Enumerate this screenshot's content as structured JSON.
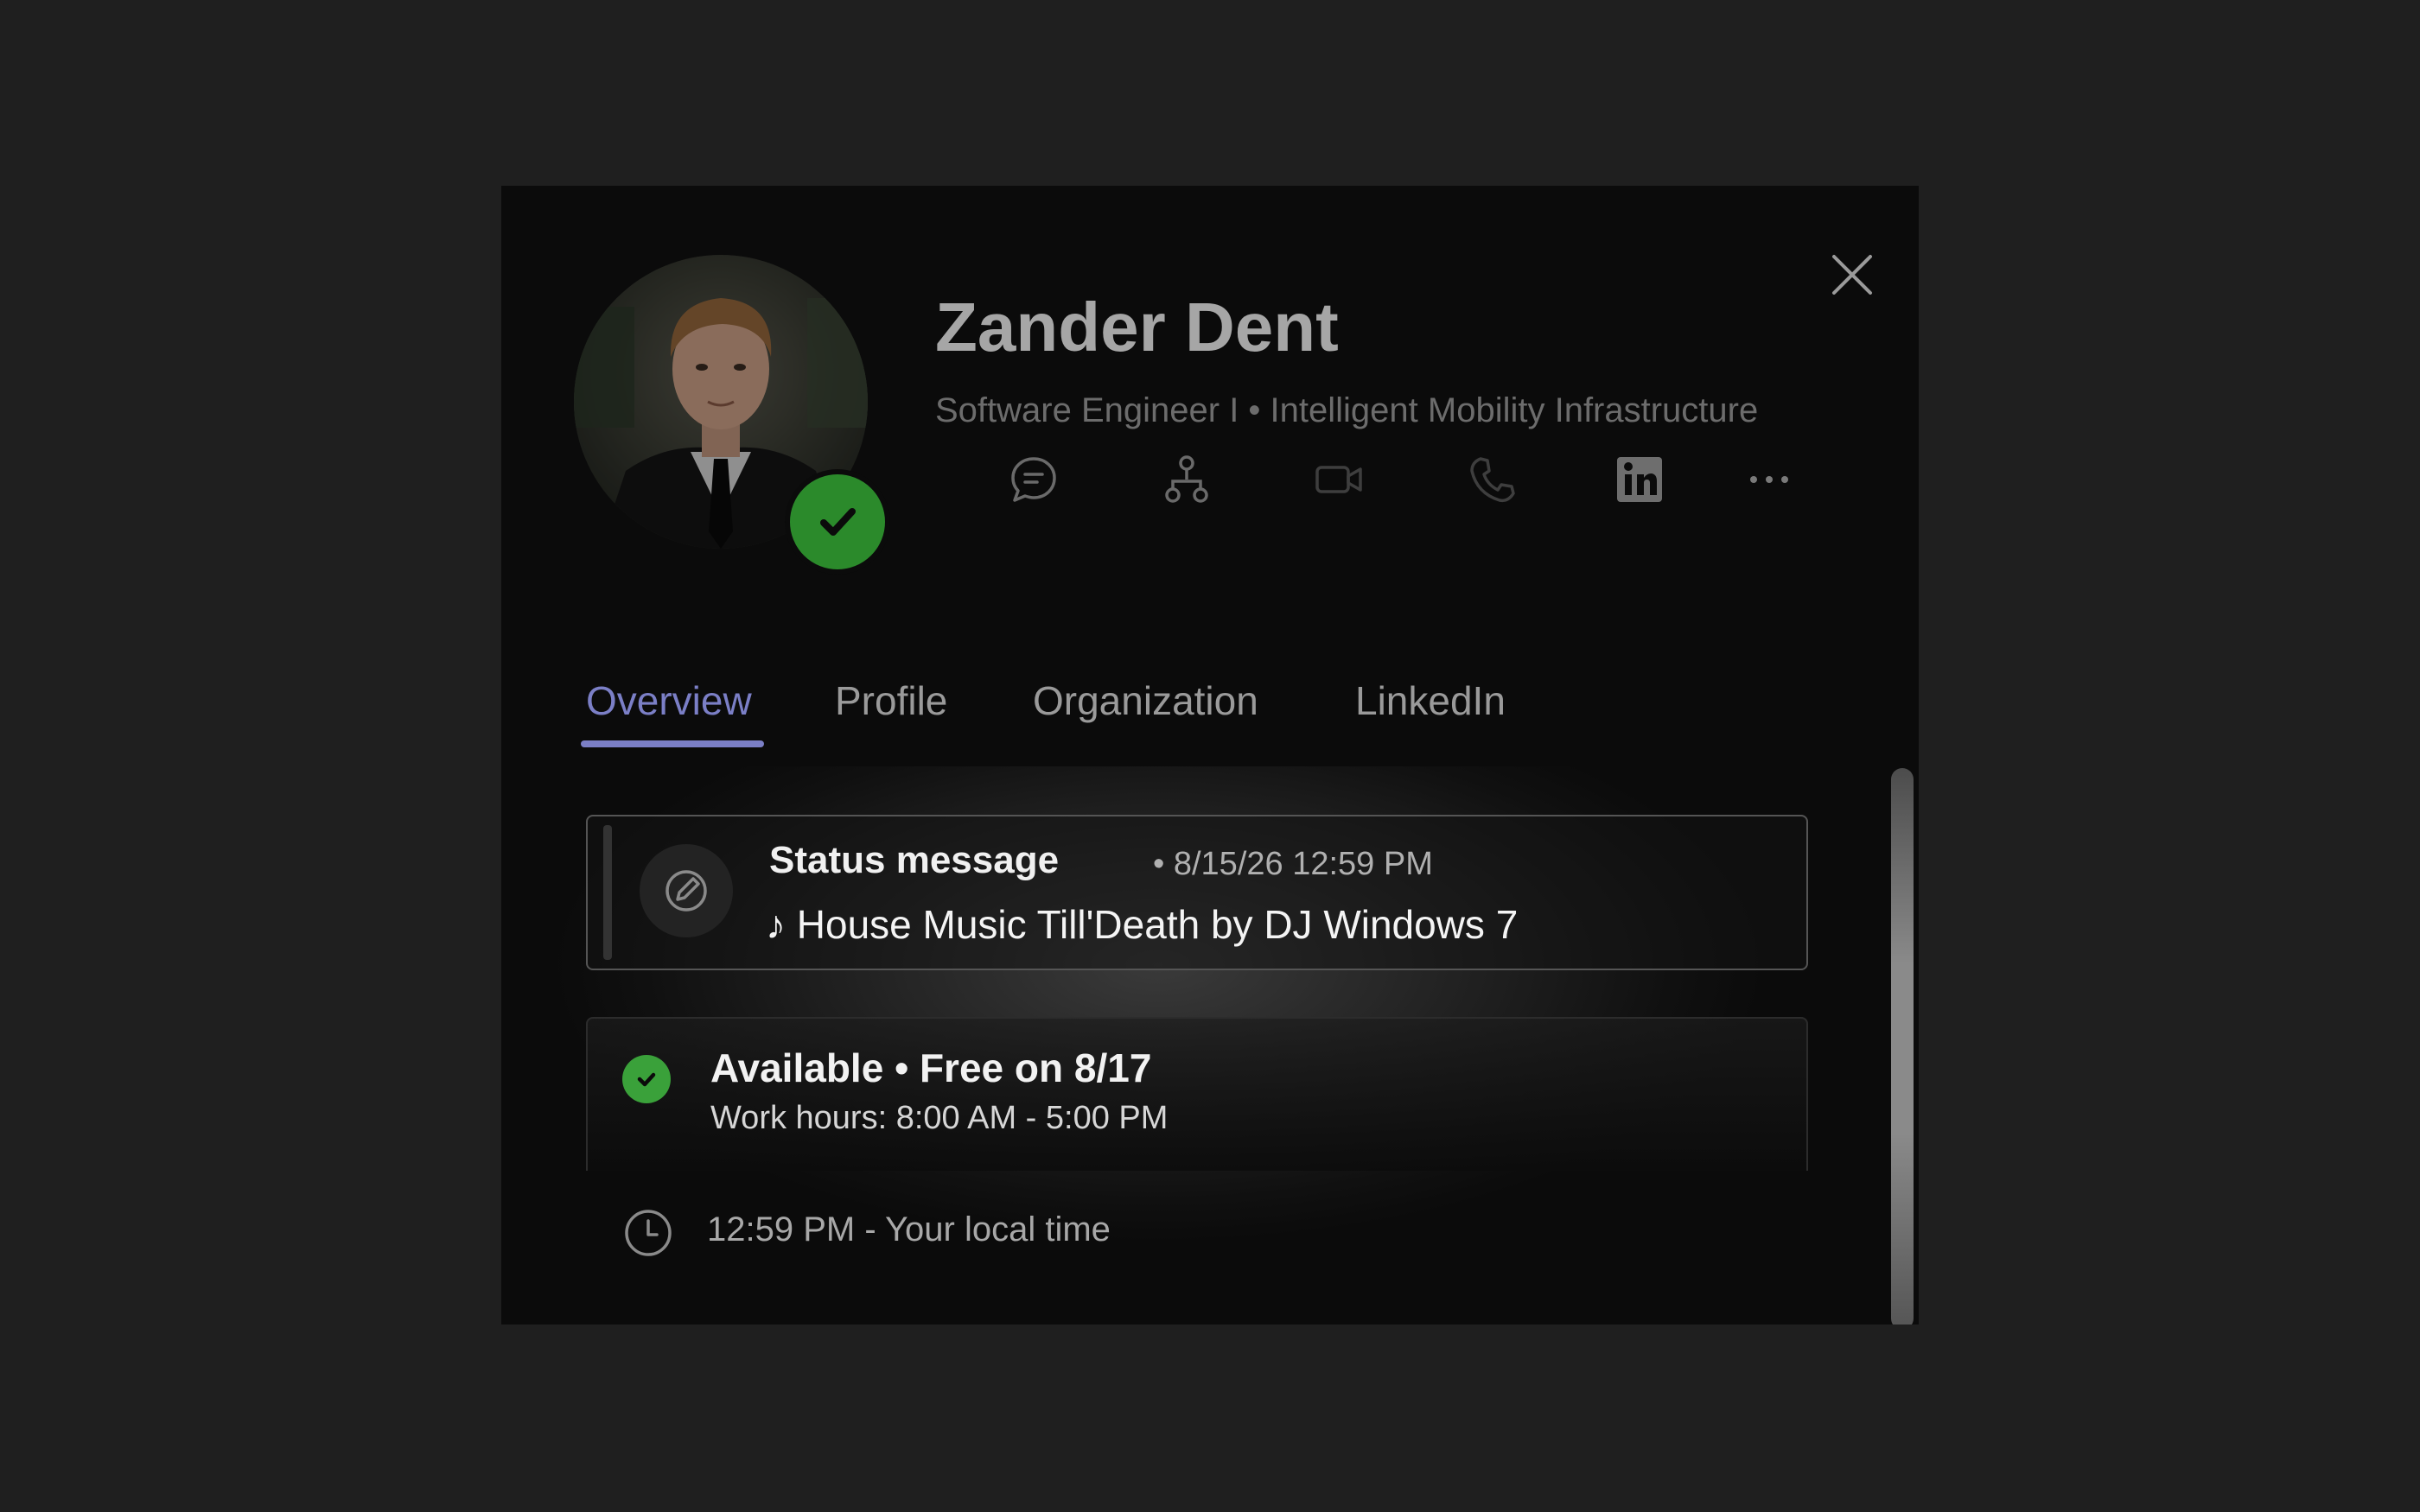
{
  "profile": {
    "name": "Zander Dent",
    "subtitle": "Software Engineer I • Intelligent Mobility Infrastructure",
    "presence": "available"
  },
  "actions": {
    "items": [
      "chat-icon",
      "org-chart-icon",
      "video-call-icon",
      "phone-call-icon",
      "linkedin-icon",
      "more-icon"
    ]
  },
  "tabs": {
    "overview": "Overview",
    "profile": "Profile",
    "organization": "Organization",
    "linkedin": "LinkedIn",
    "active": "Overview"
  },
  "status": {
    "title": "Status message",
    "date": "• 8/15/26 12:59 PM",
    "message": "♪ House Music Till'Death by DJ Windows 7"
  },
  "availability": {
    "title": "Available • Free on 8/17",
    "hours": "Work hours: 8:00 AM - 5:00 PM"
  },
  "local_time": {
    "text": "12:59 PM - Your local time"
  },
  "colors": {
    "accent": "#7b7fc6",
    "presence_green": "#2b8a2b",
    "background": "#1f1f1f",
    "card": "#0b0b0b"
  }
}
